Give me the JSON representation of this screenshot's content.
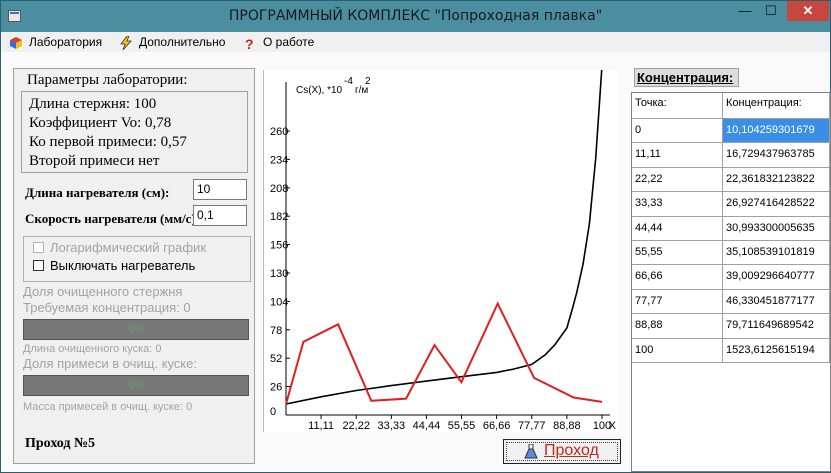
{
  "window": {
    "title": "ПРОГРАММНЫЙ КОМПЛЕКС \"Попроходная плавка\"",
    "minimize": "—",
    "maximize": "☐",
    "close": "✕"
  },
  "menu": [
    {
      "label": "Лаборатория",
      "icon": "lab-icon"
    },
    {
      "label": "Дополнительно",
      "icon": "lightning-icon"
    },
    {
      "label": "О работе",
      "icon": "question-icon"
    }
  ],
  "params": {
    "legend": "Параметры лаборатории:",
    "lines": [
      "Длина стержня: 100",
      "Коэффициент Vo: 0,78",
      "Ко первой примеси: 0,57",
      "Второй примеси нет"
    ]
  },
  "heater_length": {
    "label": "Длина нагревателя (см):",
    "value": "10"
  },
  "heater_speed": {
    "label": "Скорость нагревателя (мм/с):",
    "value": "0,1"
  },
  "options": {
    "log_graph": "Логарифмический график",
    "heater_off": "Выключать нагреватель"
  },
  "stats": {
    "cleaned_fraction": "Доля очищенного стержня",
    "required_conc": "Требуемая концентрация: 0",
    "progress1": "0%",
    "cleaned_length": "Длина очищенного куска: 0",
    "impurity_fraction": "Доля примеси в очищ. куске:",
    "progress2": "0%",
    "impurity_mass": "Масса примесей в очищ. куске: 0"
  },
  "pass_label": "Проход №5",
  "pass_button": "Проход",
  "plot": {
    "ylabel": "Cs(X), *10",
    "ylabel_exp": "-4",
    "ylabel_unit": "г/м",
    "ylabel_unit_exp": "2",
    "xlabel": "X"
  },
  "concentration": {
    "header": "Концентрация:",
    "col_point": "Точка:",
    "col_conc": "Концентрация:",
    "rows": [
      {
        "point": "0",
        "conc": "10,104259301679"
      },
      {
        "point": "11,11",
        "conc": "16,729437963785"
      },
      {
        "point": "22,22",
        "conc": "22,361832123822"
      },
      {
        "point": "33,33",
        "conc": "26,927416428522"
      },
      {
        "point": "44,44",
        "conc": "30,993300005635"
      },
      {
        "point": "55,55",
        "conc": "35,108539101819"
      },
      {
        "point": "66,66",
        "conc": "39,009296640777"
      },
      {
        "point": "77,77",
        "conc": "46,330451877177"
      },
      {
        "point": "88,88",
        "conc": "79,711649689542"
      },
      {
        "point": "100",
        "conc": "1523,6125615194"
      }
    ]
  },
  "chart_data": {
    "type": "line",
    "xlabel": "X",
    "ylabel": "Cs(X), *10^-4 г/м^2",
    "x_ticks": [
      "11,11",
      "22,22",
      "33,33",
      "44,44",
      "55,55",
      "66,66",
      "77,77",
      "88,88",
      "100"
    ],
    "y_ticks": [
      "0",
      "26",
      "52",
      "78",
      "104",
      "130",
      "156",
      "182",
      "208",
      "234",
      "260"
    ],
    "xlim": [
      0,
      100
    ],
    "ylim": [
      0,
      260
    ],
    "series": [
      {
        "color": "#000000",
        "x": [
          0,
          11.11,
          22.22,
          33.33,
          44.44,
          55.55,
          66.66,
          72,
          77.77,
          82,
          85,
          88.88,
          90.5,
          92,
          94,
          96,
          98,
          100
        ],
        "y": [
          10.1,
          16.7,
          22.4,
          26.9,
          31.0,
          35.1,
          39.0,
          42,
          46.3,
          55,
          64,
          79.7,
          96,
          112,
          138,
          175,
          235,
          320
        ]
      },
      {
        "color": "#e02020",
        "x": [
          0,
          5.5,
          16.5,
          27,
          38,
          47,
          55.5,
          67,
          78.5,
          91,
          100
        ],
        "y": [
          10,
          67,
          83,
          13,
          15,
          64,
          30,
          102,
          34,
          16,
          12
        ]
      }
    ]
  }
}
